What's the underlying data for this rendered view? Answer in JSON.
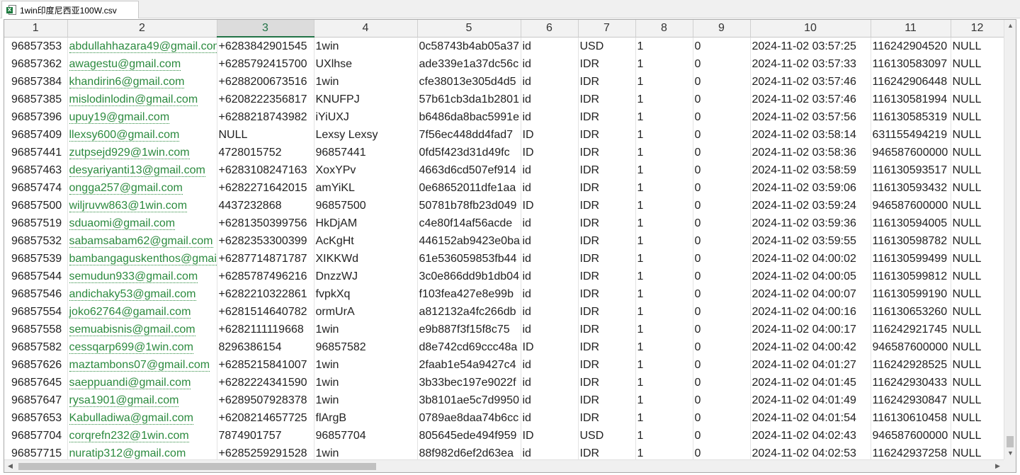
{
  "tab": {
    "title": "1win印度尼西亚100W.csv",
    "icon": "excel-file-icon",
    "badge": "X"
  },
  "grid": {
    "selected_column": "3",
    "headers": [
      "1",
      "2",
      "3",
      "4",
      "5",
      "6",
      "7",
      "8",
      "9",
      "10",
      "11",
      "12"
    ],
    "rows": [
      [
        "96857353",
        "abdullahhazara49@gmail.com",
        "+6283842901545",
        "1win",
        "0c58743b4ab05a37",
        "id",
        "USD",
        "1",
        "0",
        "2024-11-02 03:57:25",
        "116242904520",
        "NULL"
      ],
      [
        "96857362",
        "awagestu@gmail.com",
        "+6285792415700",
        "UXlhse",
        "ade339e1a37dc56c",
        "id",
        "IDR",
        "1",
        "0",
        "2024-11-02 03:57:33",
        "116130583097",
        "NULL"
      ],
      [
        "96857384",
        "khandirin6@gmail.com",
        "+6288200673516",
        "1win",
        "cfe38013e305d4d5",
        "id",
        "IDR",
        "1",
        "0",
        "2024-11-02 03:57:46",
        "116242906448",
        "NULL"
      ],
      [
        "96857385",
        "mislodinlodin@gmail.com",
        "+6208222356817",
        "KNUFPJ",
        "57b61cb3da1b2801",
        "id",
        "IDR",
        "1",
        "0",
        "2024-11-02 03:57:46",
        "116130581994",
        "NULL"
      ],
      [
        "96857396",
        "upuy19@gmail.com",
        "+6288218743982",
        "iYiUXJ",
        "b6486da8bac5991e",
        "id",
        "IDR",
        "1",
        "0",
        "2024-11-02 03:57:56",
        "116130585319",
        "NULL"
      ],
      [
        "96857409",
        "llexsy600@gmail.com",
        "NULL",
        "Lexsy Lexsy",
        "7f56ec448dd4fad7",
        "ID",
        "IDR",
        "1",
        "0",
        "2024-11-02 03:58:14",
        "631155494219",
        "NULL"
      ],
      [
        "96857441",
        "zutpsejd929@1win.com",
        "4728015752",
        "96857441",
        "0fd5f423d31d49fc",
        "ID",
        "IDR",
        "1",
        "0",
        "2024-11-02 03:58:36",
        "946587600000",
        "NULL"
      ],
      [
        "96857463",
        "desyariyanti13@gmail.com",
        "+6283108247163",
        "XoxYPv",
        "4663d6cd507ef914",
        "id",
        "IDR",
        "1",
        "0",
        "2024-11-02 03:58:59",
        "116130593517",
        "NULL"
      ],
      [
        "96857474",
        "ongga257@gmail.com",
        "+6282271642015",
        "amYiKL",
        "0e68652011dfe1aa",
        "id",
        "IDR",
        "1",
        "0",
        "2024-11-02 03:59:06",
        "116130593432",
        "NULL"
      ],
      [
        "96857500",
        "wiljruvw863@1win.com",
        "4437232868",
        "96857500",
        "50781b78fb23d049",
        "ID",
        "IDR",
        "1",
        "0",
        "2024-11-02 03:59:24",
        "946587600000",
        "NULL"
      ],
      [
        "96857519",
        "sduaomi@gmail.com",
        "+6281350399756",
        "HkDjAM",
        "c4e80f14af56acde",
        "id",
        "IDR",
        "1",
        "0",
        "2024-11-02 03:59:36",
        "116130594005",
        "NULL"
      ],
      [
        "96857532",
        "sabamsabam62@gmail.com",
        "+6282353300399",
        "AcKgHt",
        "446152ab9423e0ba",
        "id",
        "IDR",
        "1",
        "0",
        "2024-11-02 03:59:55",
        "116130598782",
        "NULL"
      ],
      [
        "96857539",
        "bambangaguskenthos@gmail.com",
        "+6287714871787",
        "XIKKWd",
        "61e536059853fb44",
        "id",
        "IDR",
        "1",
        "0",
        "2024-11-02 04:00:02",
        "116130599499",
        "NULL"
      ],
      [
        "96857544",
        "semudun933@gmail.com",
        "+6285787496216",
        "DnzzWJ",
        "3c0e866dd9b1db04",
        "id",
        "IDR",
        "1",
        "0",
        "2024-11-02 04:00:05",
        "116130599812",
        "NULL"
      ],
      [
        "96857546",
        "andichaky53@gmail.com",
        "+6282210322861",
        "fvpkXq",
        "f103fea427e8e99b",
        "id",
        "IDR",
        "1",
        "0",
        "2024-11-02 04:00:07",
        "116130599190",
        "NULL"
      ],
      [
        "96857554",
        "joko62764@gamail.com",
        "+6281514640782",
        "ormUrA",
        "a812132a4fc266db",
        "id",
        "IDR",
        "1",
        "0",
        "2024-11-02 04:00:16",
        "116130653260",
        "NULL"
      ],
      [
        "96857558",
        "semuabisnis@gmail.com",
        "+6282111119668",
        "1win",
        "e9b887f3f15f8c75",
        "id",
        "IDR",
        "1",
        "0",
        "2024-11-02 04:00:17",
        "116242921745",
        "NULL"
      ],
      [
        "96857582",
        "cessqarp699@1win.com",
        "8296386154",
        "96857582",
        "d8e742cd69ccc48a",
        "ID",
        "IDR",
        "1",
        "0",
        "2024-11-02 04:00:42",
        "946587600000",
        "NULL"
      ],
      [
        "96857626",
        "maztambons07@gmail.com",
        "+6285215841007",
        "1win",
        "2faab1e54a9427c4",
        "id",
        "IDR",
        "1",
        "0",
        "2024-11-02 04:01:27",
        "116242928525",
        "NULL"
      ],
      [
        "96857645",
        "saeppuandi@gmail.com",
        "+6282224341590",
        "1win",
        "3b33bec197e9022f",
        "id",
        "IDR",
        "1",
        "0",
        "2024-11-02 04:01:45",
        "116242930433",
        "NULL"
      ],
      [
        "96857647",
        "rysa1901@gmail.com",
        "+6289507928378",
        "1win",
        "3b8101ae5c7d9950",
        "id",
        "IDR",
        "1",
        "0",
        "2024-11-02 04:01:49",
        "116242930847",
        "NULL"
      ],
      [
        "96857653",
        "Kabulladiwa@gmail.com",
        "+6208214657725",
        "flArgB",
        "0789ae8daa74b6cc",
        "id",
        "IDR",
        "1",
        "0",
        "2024-11-02 04:01:54",
        "116130610458",
        "NULL"
      ],
      [
        "96857704",
        "corqrefn232@1win.com",
        "7874901757",
        "96857704",
        "805645ede494f959",
        "ID",
        "USD",
        "1",
        "0",
        "2024-11-02 04:02:43",
        "946587600000",
        "NULL"
      ],
      [
        "96857715",
        "nuratip312@gmail.com",
        "+6285259291528",
        "1win",
        "88f982d6ef2d63ea",
        "id",
        "IDR",
        "1",
        "0",
        "2024-11-02 04:02:53",
        "116242937258",
        "NULL"
      ]
    ]
  },
  "scrollbars": {
    "up": "▲",
    "down": "▼",
    "left": "◀",
    "right": "▶",
    "icons": {
      "up": "scroll-up-icon",
      "down": "scroll-down-icon",
      "left": "scroll-left-icon",
      "right": "scroll-right-icon"
    }
  }
}
